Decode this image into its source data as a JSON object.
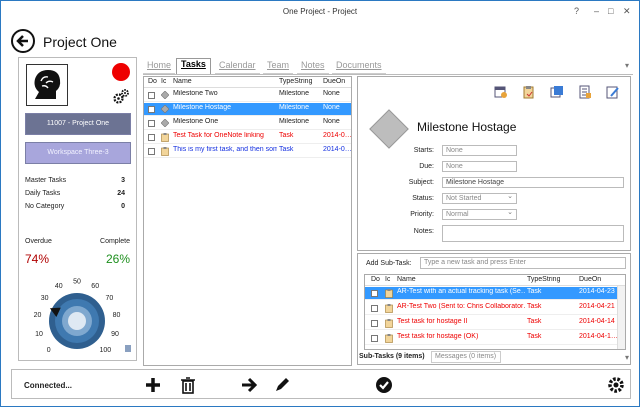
{
  "window": {
    "title": "One Project - Project",
    "controls": [
      "?",
      "–",
      "□",
      "✕"
    ]
  },
  "header": {
    "title": "Project One"
  },
  "left": {
    "project_button": "11007 - Project One",
    "workspace_button": "Workspace Three-3",
    "stats": [
      {
        "label": "Master Tasks",
        "value": "3"
      },
      {
        "label": "Daily Tasks",
        "value": "24"
      },
      {
        "label": "No Category",
        "value": "0"
      }
    ],
    "overdue_label": "Overdue",
    "complete_label": "Complete",
    "overdue_value": "74%",
    "complete_value": "26%",
    "dial_ticks": [
      "0",
      "10",
      "20",
      "30",
      "40",
      "50",
      "60",
      "70",
      "80",
      "90",
      "100"
    ],
    "dial_level": 26
  },
  "tabs": [
    "Home",
    "Tasks",
    "Calendar",
    "Team",
    "Notes",
    "Documents"
  ],
  "active_tab": "Tasks",
  "task_table": {
    "columns": [
      "Do",
      "Ic",
      "Name",
      "TypeString",
      "DueOn"
    ],
    "rows": [
      {
        "name": "Milestone Two",
        "type": "Milestone",
        "due": "None",
        "style": ""
      },
      {
        "name": "Milestone Hostage",
        "type": "Milestone",
        "due": "None",
        "style": "sel"
      },
      {
        "name": "Milestone One",
        "type": "Milestone",
        "due": "None",
        "style": ""
      },
      {
        "name": "Test Task for OneNote linking",
        "type": "Task",
        "due": "2014-0…",
        "style": "red"
      },
      {
        "name": "This is my first task, and then some",
        "type": "Task",
        "due": "2014-0…",
        "style": "blue"
      }
    ]
  },
  "detail": {
    "title": "Milestone Hostage",
    "fields": {
      "starts_label": "Starts:",
      "starts_value": "None",
      "due_label": "Due:",
      "due_value": "None",
      "subject_label": "Subject:",
      "subject_value": "Milestone Hostage",
      "status_label": "Status:",
      "status_value": "Not Started",
      "priority_label": "Priority:",
      "priority_value": "Normal",
      "notes_label": "Notes:"
    }
  },
  "subtasks": {
    "label": "Add Sub-Task:",
    "placeholder": "Type a new task and press Enter",
    "columns": [
      "Do",
      "Ic",
      "Name",
      "TypeString",
      "DueOn"
    ],
    "rows": [
      {
        "name": "AR-Test with an actual tracking task (Se…",
        "type": "Task",
        "due": "2014-04-23",
        "style": "sel"
      },
      {
        "name": "AR-Test Two (Sent to: Chris Collaborator…",
        "type": "Task",
        "due": "2014-04-21",
        "style": "red"
      },
      {
        "name": "Test task for hostage II",
        "type": "Task",
        "due": "2014-04-14",
        "style": "red"
      },
      {
        "name": "Test task for hostage (OK)",
        "type": "Task",
        "due": "2014-04-1…",
        "style": "red"
      }
    ],
    "tab_subtasks": "Sub-Tasks (9 items)",
    "tab_messages": "Messages (0 items)"
  },
  "footer": {
    "status": "Connected..."
  },
  "colors": {
    "accent": "#3399ff",
    "overdue": "#b00000",
    "complete": "#1d8f1d",
    "record": "#ee0000"
  }
}
